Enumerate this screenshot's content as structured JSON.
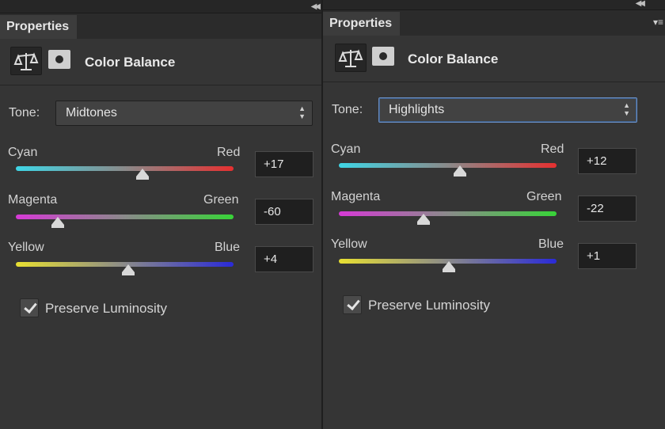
{
  "panels": [
    {
      "tab_label": "Properties",
      "title": "Color Balance",
      "tone_label": "Tone:",
      "tone_value": "Midtones",
      "sliders": [
        {
          "left_label": "Cyan",
          "right_label": "Red",
          "value": "+17",
          "position": 0.59
        },
        {
          "left_label": "Magenta",
          "right_label": "Green",
          "value": "-60",
          "position": 0.2
        },
        {
          "left_label": "Yellow",
          "right_label": "Blue",
          "value": "+4",
          "position": 0.52
        }
      ],
      "preserve_luminosity_label": "Preserve Luminosity",
      "preserve_luminosity_checked": true
    },
    {
      "tab_label": "Properties",
      "title": "Color Balance",
      "tone_label": "Tone:",
      "tone_value": "Highlights",
      "sliders": [
        {
          "left_label": "Cyan",
          "right_label": "Red",
          "value": "+12",
          "position": 0.56
        },
        {
          "left_label": "Magenta",
          "right_label": "Green",
          "value": "-22",
          "position": 0.39
        },
        {
          "left_label": "Yellow",
          "right_label": "Blue",
          "value": "+1",
          "position": 0.51
        }
      ],
      "preserve_luminosity_label": "Preserve Luminosity",
      "preserve_luminosity_checked": true
    }
  ],
  "icons": [
    "collapse-panels-icon",
    "scales-balance-icon",
    "layer-mask-icon",
    "select-arrows-icon",
    "panel-menu-icon",
    "checkmark-icon"
  ],
  "colors": {
    "panel_bg": "#353535",
    "cyan_red_gradient": [
      "#3fd6e6",
      "#e63030"
    ],
    "magenta_green_gradient": [
      "#d63ad6",
      "#38d438"
    ],
    "yellow_blue_gradient": [
      "#e8e032",
      "#2a2ad8"
    ],
    "focus_border": "#6b8fc2"
  }
}
